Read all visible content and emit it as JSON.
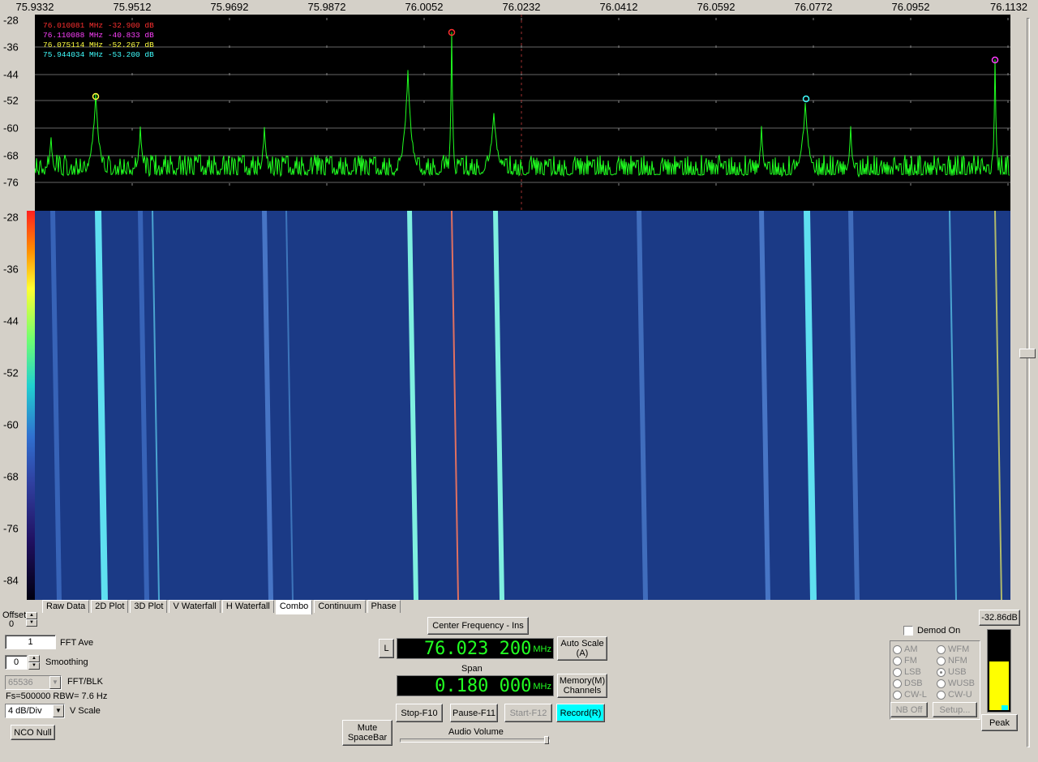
{
  "freq_axis": [
    "75.9332",
    "75.9512",
    "75.9692",
    "75.9872",
    "76.0052",
    "76.0232",
    "76.0412",
    "76.0592",
    "76.0772",
    "76.0952",
    "76.1132"
  ],
  "db_axis_spectrum": [
    "-28",
    "-36",
    "-44",
    "-52",
    "-60",
    "-68",
    "-76"
  ],
  "db_axis_waterfall": [
    "-28",
    "-36",
    "-44",
    "-52",
    "-60",
    "-68",
    "-76",
    "-84"
  ],
  "markers": [
    {
      "text": "76.010081 MHz  -32.900  dB",
      "color": "#ff3030"
    },
    {
      "text": "76.110088 MHz  -40.833  dB",
      "color": "#ff40ff"
    },
    {
      "text": "76.075114 MHz  -52.267  dB",
      "color": "#ffff40"
    },
    {
      "text": "75.944034 MHz  -53.200  dB",
      "color": "#40ffff"
    }
  ],
  "tabs": [
    "Raw Data",
    "2D Plot",
    "3D Plot",
    "V Waterfall",
    "H Waterfall",
    "Combo",
    "Continuum",
    "Phase"
  ],
  "active_tab": "Combo",
  "offset": {
    "label": "Offset",
    "value": "0"
  },
  "fft_ave": {
    "value": "1",
    "label": "FFT Ave"
  },
  "smoothing": {
    "value": "0",
    "label": "Smoothing"
  },
  "fft_blk": {
    "value": "65536",
    "label": "FFT/BLK"
  },
  "fs_info": "Fs=500000 RBW= 7.6 Hz",
  "vscale": {
    "value": "4 dB/Div",
    "label": "V Scale"
  },
  "nco_null": "NCO Null",
  "center_freq_btn": "Center Frequency - Ins",
  "l_btn": "L",
  "center_freq": "76.023 200",
  "unit": "MHz",
  "auto_scale": "Auto Scale (A)",
  "span_label": "Span",
  "span": "0.180 000",
  "memory_btn": "Memory(M) Channels",
  "stop_btn": "Stop-F10",
  "pause_btn": "Pause-F11",
  "start_btn": "Start-F12",
  "record_btn": "Record(R)",
  "mute_btn": "Mute SpaceBar",
  "audio_volume": "Audio Volume",
  "demod_on": "Demod On",
  "modes": [
    "AM",
    "WFM",
    "FM",
    "NFM",
    "LSB",
    "USB",
    "DSB",
    "WUSB",
    "CW-L",
    "CW-U"
  ],
  "selected_mode": "USB",
  "nb_off": "NB Off",
  "setup": "Setup...",
  "peak_db": "-32.86dB",
  "peak_btn": "Peak",
  "peak_level": 0.62
}
